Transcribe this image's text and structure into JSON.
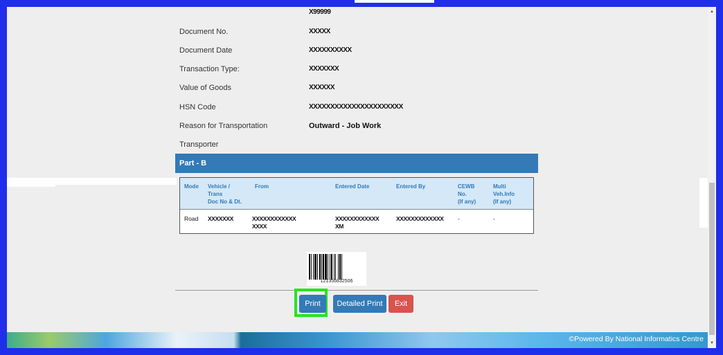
{
  "top_value": "X99999",
  "details": [
    {
      "label": "Document No.",
      "value": "XXXXX"
    },
    {
      "label": "Document Date",
      "value": "XXXXXXXXXX"
    },
    {
      "label": "Transaction Type:",
      "value": "XXXXXXX"
    },
    {
      "label": "Value of Goods",
      "value": "XXXXXX"
    },
    {
      "label": "HSN Code",
      "value": "XXXXXXXXXXXXXXXXXXXXXX"
    },
    {
      "label": "Reason for Transportation",
      "value": "Outward - Job Work"
    },
    {
      "label": "Transporter",
      "value": ""
    }
  ],
  "part_b": {
    "title": "Part - B",
    "headers": {
      "mode": "Mode",
      "vehicle_1": "Vehicle /",
      "vehicle_2": "Trans",
      "vehicle_3": "Doc No & Dt.",
      "from": "From",
      "entered_date": "Entered Date",
      "entered_by": "Entered By",
      "cewb_1": "CEWB",
      "cewb_2": "No.",
      "cewb_3": "(If any)",
      "multi_1": "Multi",
      "multi_2": "Veh.Info",
      "multi_3": "(If any)"
    },
    "row": {
      "mode": "Road",
      "vehicle": "XXXXXXX",
      "from_1": "XXXXXXXXXXXX",
      "from_2": "XXXX",
      "entered_date_1": "XXXXXXXXXXXX",
      "entered_date_2": "XM",
      "entered_by": "XXXXXXXXXXXXX",
      "cewb": "-",
      "multi": "-"
    }
  },
  "barcode_number": "121356832506",
  "buttons": {
    "print": "Print",
    "detailed_print": "Detailed Print",
    "exit": "Exit"
  },
  "footer": {
    "text": "©Powered By National Informatics Centre"
  },
  "colors": {
    "primary": "#337ab7",
    "danger": "#d9534f",
    "highlight": "#26e51f",
    "frame": "#1f2eea"
  }
}
